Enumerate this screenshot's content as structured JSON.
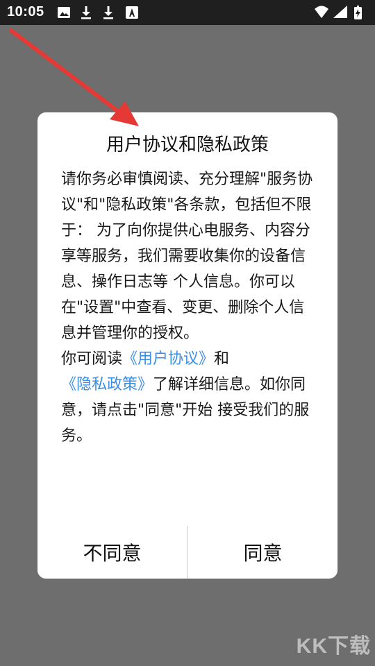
{
  "status_bar": {
    "time": "10:05",
    "icons": [
      "image-icon",
      "download-icon",
      "download-icon",
      "font-icon",
      "wifi-icon",
      "signal-icon",
      "battery-icon"
    ]
  },
  "dialog": {
    "title": "用户协议和隐私政策",
    "paragraph1": "请你务必审慎阅读、充分理解\"服务协议\"和\"隐私政策\"各条款，包括但不限于： 为了向你提供心电服务、内容分享等服务，我们需要收集你的设备信息、操作日志等 个人信息。你可以在\"设置\"中查看、变更、删除个人信息并管理你的授权。",
    "paragraph2_prefix": "你可阅读",
    "user_agreement_link": "《用户协议》",
    "paragraph2_and": "和",
    "privacy_policy_link": "《隐私政策》",
    "paragraph2_suffix": "了解详细信息。如你同意，请点击\"同意\"开始 接受我们的服务。",
    "disagree_label": "不同意",
    "agree_label": "同意"
  },
  "watermark": "KK下载",
  "colors": {
    "link": "#3a8ee6",
    "arrow": "#e53935",
    "overlay": "#6e6e6e"
  }
}
